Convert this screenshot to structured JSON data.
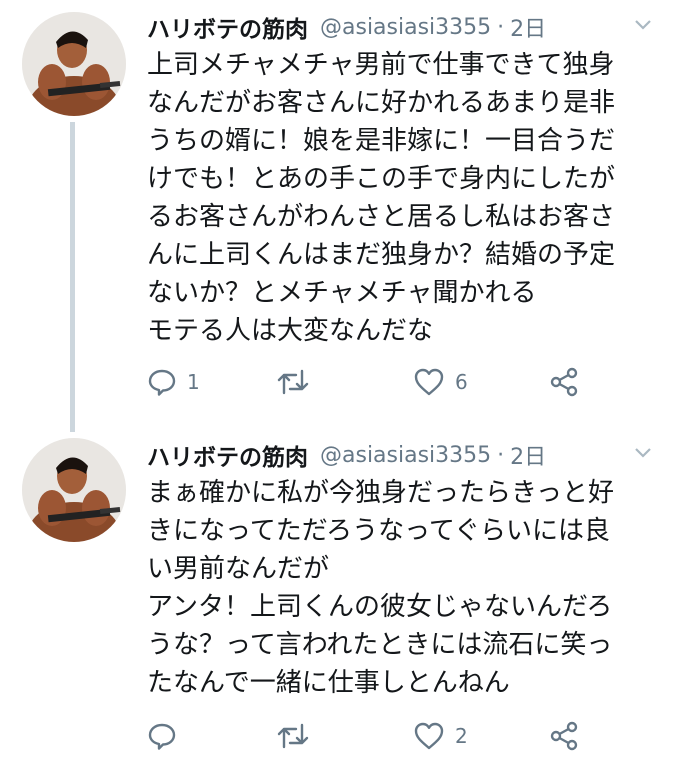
{
  "colors": {
    "text": "#14171a",
    "secondary": "#657786",
    "thread_line": "#ccd6dd",
    "icon": "#657786"
  },
  "tweets": [
    {
      "display_name": "ハリボテの筋肉",
      "handle": "@asiasiasi3355",
      "separator": "·",
      "time": "2日",
      "lines": [
        "上司メチャメチャ男前で仕事できて独身",
        "なんだがお客さんに好かれるあまり是非",
        "うちの婿に！娘を是非嫁に！一目合うだ",
        "けでも！とあの手この手で身内にしたが",
        "るお客さんがわんさと居るし私はお客さ",
        "んに上司くんはまだ独身か？結婚の予定",
        "ないか？とメチャメチャ聞かれる",
        "モテる人は大変なんだな"
      ],
      "reply_count": "1",
      "retweet_count": "",
      "like_count": "6"
    },
    {
      "display_name": "ハリボテの筋肉",
      "handle": "@asiasiasi3355",
      "separator": "·",
      "time": "2日",
      "lines": [
        "まぁ確かに私が今独身だったらきっと好",
        "きになってただろうなってぐらいには良",
        "い男前なんだが",
        "アンタ！上司くんの彼女じゃないんだろ",
        "うな？って言われたときには流石に笑っ",
        "たなんで一緒に仕事しとんねん"
      ],
      "reply_count": "",
      "retweet_count": "",
      "like_count": "2"
    }
  ],
  "icons": {
    "reply": "reply-icon",
    "retweet": "retweet-icon",
    "like": "heart-icon",
    "share": "share-icon",
    "caret": "chevron-down-icon"
  }
}
